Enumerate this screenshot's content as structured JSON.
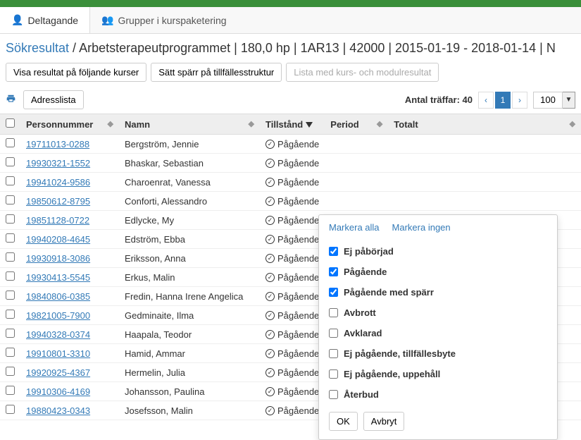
{
  "tabs": {
    "participation": {
      "label": "Deltagande"
    },
    "groups": {
      "label": "Grupper i kurspaketering"
    }
  },
  "breadcrumb": {
    "link": "Sökresultat",
    "sep": " / ",
    "rest": "Arbetsterapeutprogrammet | 180,0 hp | 1AR13 | 42000 | 2015-01-19 - 2018-01-14 | N"
  },
  "actions": {
    "show_courses": "Visa resultat på följande kurser",
    "set_block": "Sätt spärr på tillfällesstruktur",
    "list_results": "Lista med kurs- och modulresultat",
    "address_list": "Adresslista"
  },
  "pager": {
    "hits_label": "Antal träffar: 40",
    "page": "1",
    "pagesize": "100"
  },
  "columns": {
    "pnr": "Personnummer",
    "name": "Namn",
    "status": "Tillstånd",
    "period": "Period",
    "total": "Totalt"
  },
  "status_text": "Pågående",
  "rows": [
    {
      "pnr": "19711013-0288",
      "name": "Bergström, Jennie"
    },
    {
      "pnr": "19930321-1552",
      "name": "Bhaskar, Sebastian"
    },
    {
      "pnr": "19941024-9586",
      "name": "Charoenrat, Vanessa"
    },
    {
      "pnr": "19850612-8795",
      "name": "Conforti, Alessandro"
    },
    {
      "pnr": "19851128-0722",
      "name": "Edlycke, My"
    },
    {
      "pnr": "19940208-4645",
      "name": "Edström, Ebba"
    },
    {
      "pnr": "19930918-3086",
      "name": "Eriksson, Anna"
    },
    {
      "pnr": "19930413-5545",
      "name": "Erkus, Malin"
    },
    {
      "pnr": "19840806-0385",
      "name": "Fredin, Hanna Irene Angelica"
    },
    {
      "pnr": "19821005-7900",
      "name": "Gedminaite, Ilma"
    },
    {
      "pnr": "19940328-0374",
      "name": "Haapala, Teodor"
    },
    {
      "pnr": "19910801-3310",
      "name": "Hamid, Ammar"
    },
    {
      "pnr": "19920925-4367",
      "name": "Hermelin, Julia"
    },
    {
      "pnr": "19910306-4169",
      "name": "Johansson, Paulina"
    },
    {
      "pnr": "19880423-0343",
      "name": "Josefsson, Malin"
    }
  ],
  "popover": {
    "select_all": "Markera alla",
    "select_none": "Markera ingen",
    "options": [
      {
        "label": "Ej påbörjad",
        "checked": true
      },
      {
        "label": "Pågående",
        "checked": true
      },
      {
        "label": "Pågående med spärr",
        "checked": true
      },
      {
        "label": "Avbrott",
        "checked": false
      },
      {
        "label": "Avklarad",
        "checked": false
      },
      {
        "label": "Ej pågående, tillfällesbyte",
        "checked": false
      },
      {
        "label": "Ej pågående, uppehåll",
        "checked": false
      },
      {
        "label": "Återbud",
        "checked": false
      }
    ],
    "ok": "OK",
    "cancel": "Avbryt"
  }
}
